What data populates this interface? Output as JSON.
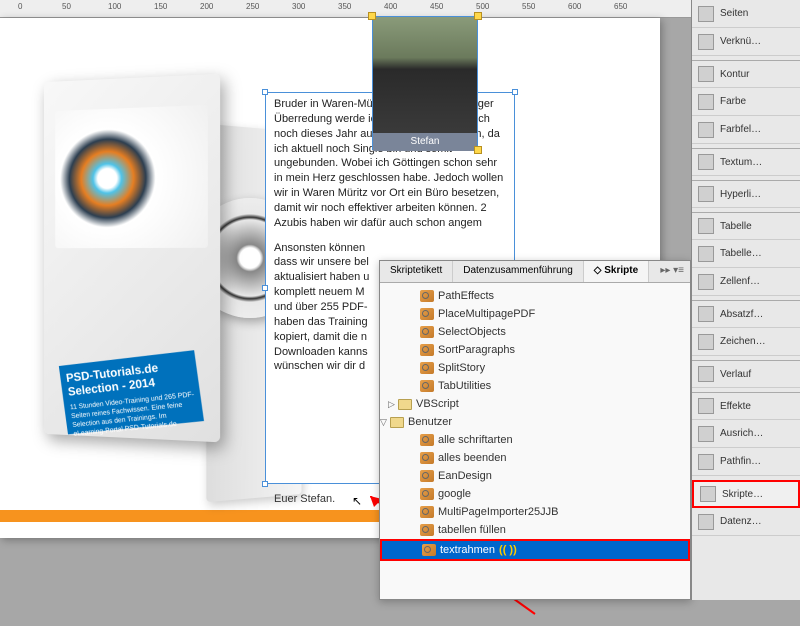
{
  "ruler": [
    "0",
    "50",
    "100",
    "150",
    "200",
    "250",
    "300",
    "350",
    "400",
    "450",
    "500",
    "550",
    "600",
    "650"
  ],
  "dvd": {
    "title": "PSD-Tutorials.de Selection - 2014",
    "sub": "11 Stunden Video-Training und 265 PDF-Seiten reines Fachwissen. Eine feine Selection aus den Trainings. Im eLearning-Portal PSD-Tutorials.de"
  },
  "photo_name": "Stefan",
  "body": {
    "p1": "Bruder in Waren-Müritz und nach jahrelanger Überredung werde ich höchstwahrscheinlich noch dieses Jahr auch nach Waren ziehen, da ich aktuell noch Single bin und somit ungebunden. Wobei ich Göttingen schon sehr in mein Herz geschlossen habe. Jedoch wollen wir in Waren Müritz vor Ort ein Büro besetzen, damit wir noch effektiver arbeiten können. 2 Azubis haben wir dafür auch schon angem",
    "p2": "Ansonsten können\ndass wir unsere bel\naktualisiert haben u\nkomplett neuem M\nund über 255 PDF-\nhaben das Training\nkopiert, damit die n\nDownloaden kanns\nwünschen wir dir d"
  },
  "signature": "Euer  Stefan.",
  "panel": {
    "tabs": {
      "t1": "Skriptetikett",
      "t2": "Datenzusammenführung",
      "t3": "Skripte"
    },
    "items": [
      "PathEffects",
      "PlaceMultipagePDF",
      "SelectObjects",
      "SortParagraphs",
      "SplitStory",
      "TabUtilities"
    ],
    "folders": {
      "vb": "VBScript",
      "user": "Benutzer"
    },
    "user_items": [
      "alle schriftarten",
      "alles beenden",
      "EanDesign",
      "google",
      "MultiPageImporter25JJB",
      "tabellen füllen",
      "textrahmen"
    ]
  },
  "right": [
    "Seiten",
    "Verknü…",
    "Kontur",
    "Farbe",
    "Farbfel…",
    "Textum…",
    "Hyperli…",
    "Tabelle",
    "Tabelle…",
    "Zellenf…",
    "Absatzf…",
    "Zeichen…",
    "Verlauf",
    "Effekte",
    "Ausrich…",
    "Pathfin…",
    "Skripte…",
    "Datenz…"
  ]
}
